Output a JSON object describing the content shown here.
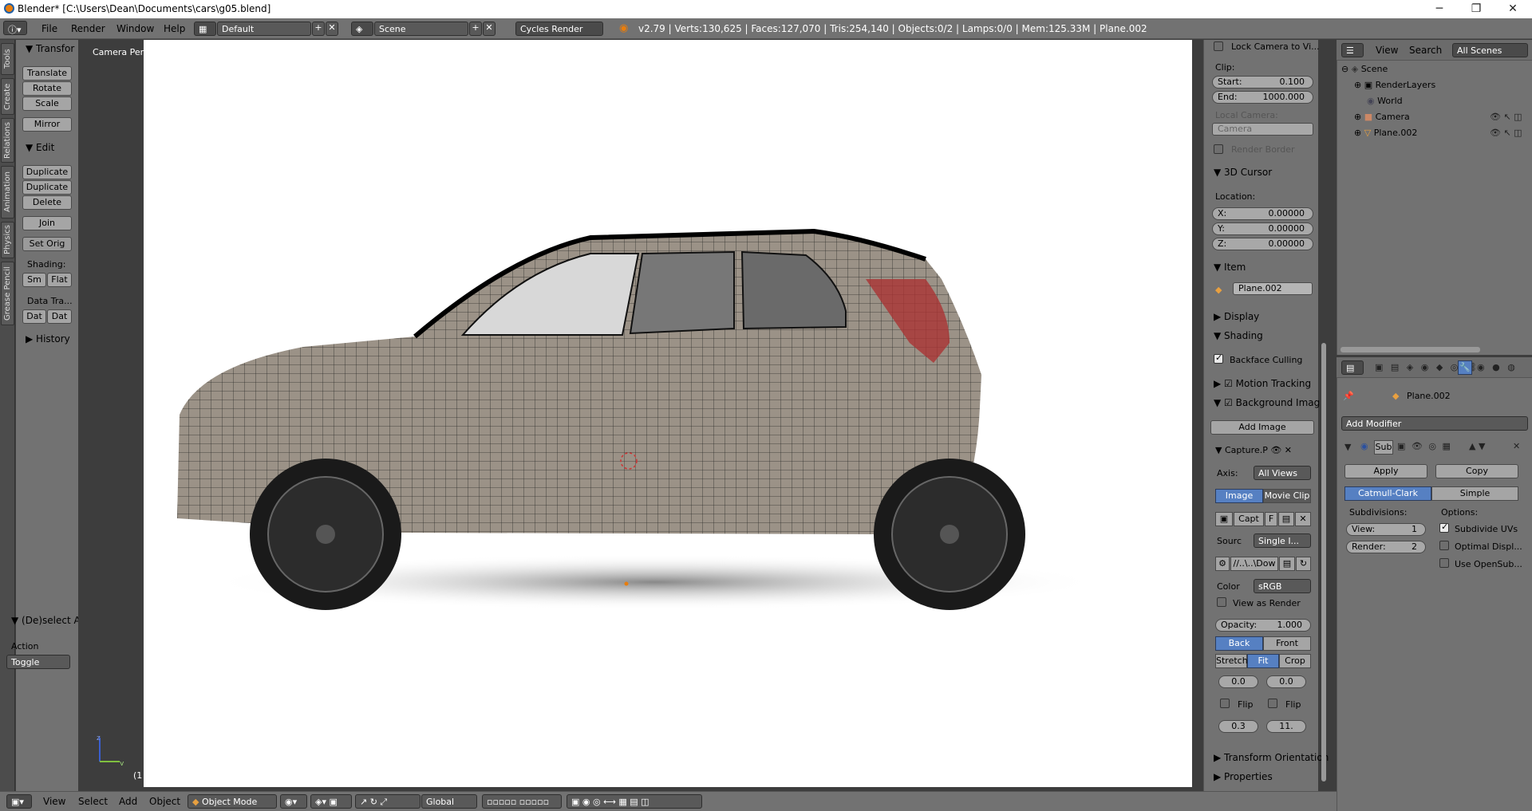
{
  "window": {
    "title": "Blender* [C:\\Users\\Dean\\Documents\\cars\\g05.blend]",
    "minimize": "─",
    "maximize": "❐",
    "close": "✕"
  },
  "topbar": {
    "menus": [
      "File",
      "Render",
      "Window",
      "Help"
    ],
    "layout": "Default",
    "scene": "Scene",
    "engine": "Cycles Render",
    "info": "v2.79 | Verts:130,625 | Faces:127,070 | Tris:254,140 | Objects:0/2 | Lamps:0/0 | Mem:125.33M | Plane.002"
  },
  "left_tabs": [
    "Tools",
    "Create",
    "Relations",
    "Animation",
    "Physics",
    "Grease Pencil"
  ],
  "toolshelf": {
    "transform_header": "Transfor",
    "transform_buttons": [
      "Translate",
      "Rotate",
      "Scale"
    ],
    "mirror": "Mirror",
    "edit_header": "Edit",
    "edit_buttons": [
      "Duplicate",
      "Duplicate",
      "Delete"
    ],
    "join": "Join",
    "set_origin": "Set Orig",
    "shading_label": "Shading:",
    "shading_buttons": [
      "Sm",
      "Flat"
    ],
    "data_transfer_label": "Data Tra...",
    "data_buttons": [
      "Dat",
      "Dat"
    ],
    "history": "History",
    "deselect_header": "(De)select Al",
    "action_label": "Action",
    "action_value": "Toggle"
  },
  "viewport": {
    "label": "Camera Persp",
    "frame_label": "(1"
  },
  "npanel": {
    "lock_camera": "Lock Camera to Vi...",
    "clip_label": "Clip:",
    "clip_start_label": "Start:",
    "clip_start": "0.100",
    "clip_end_label": "End:",
    "clip_end": "1000.000",
    "local_camera": "Local Camera:",
    "camera_field": "Camera",
    "render_border": "Render Border",
    "cursor_header": "3D Cursor",
    "location_label": "Location:",
    "x_label": "X:",
    "x": "0.00000",
    "y_label": "Y:",
    "y": "0.00000",
    "z_label": "Z:",
    "z": "0.00000",
    "item_header": "Item",
    "item_name": "Plane.002",
    "display_header": "Display",
    "shading_header": "Shading",
    "backface": "Backface Culling",
    "motion_tracking": "Motion Tracking",
    "background_images": "Background Imag",
    "add_image": "Add Image",
    "capture": "Capture.P",
    "axis_label": "Axis:",
    "axis_value": "All Views",
    "image_tab": "Image",
    "movie_tab": "Movie Clip",
    "capt_field": "Capt",
    "capt_f": "F",
    "source_label": "Sourc",
    "source_value": "Single I...",
    "path_value": "//..\\..\\Dow",
    "color_label": "Color",
    "color_value": "sRGB",
    "view_as_render": "View as Render",
    "opacity_label": "Opacity:",
    "opacity": "1.000",
    "back": "Back",
    "front": "Front",
    "stretch": "Stretch",
    "fit": "Fit",
    "crop": "Crop",
    "offset_x": "0.0",
    "offset_y": "0.0",
    "flip1": "Flip",
    "flip2": "Flip",
    "size": "0.3",
    "rotation": "11.",
    "transform_orientation": "Transform Orientation",
    "properties": "Properties"
  },
  "outliner": {
    "view": "View",
    "search": "Search",
    "all_scenes": "All Scenes",
    "items": [
      "Scene",
      "RenderLayers",
      "World",
      "Camera",
      "Plane.002"
    ]
  },
  "properties": {
    "object_name": "Plane.002",
    "add_modifier": "Add Modifier",
    "modifier_name": "Sub",
    "apply": "Apply",
    "copy": "Copy",
    "catmull": "Catmull-Clark",
    "simple": "Simple",
    "subdivisions": "Subdivisions:",
    "options": "Options:",
    "view_label": "View:",
    "view_value": "1",
    "render_label": "Render:",
    "render_value": "2",
    "subdivide_uvs": "Subdivide UVs",
    "optimal_display": "Optimal Displ...",
    "use_opensubdiv": "Use OpenSub..."
  },
  "bottombar": {
    "menus": [
      "View",
      "Select",
      "Add",
      "Object"
    ],
    "mode": "Object Mode",
    "orientation": "Global"
  },
  "colors": {
    "panel": "#727272",
    "accent": "#5680c2",
    "viewport_bg": "#3d3d3d"
  }
}
